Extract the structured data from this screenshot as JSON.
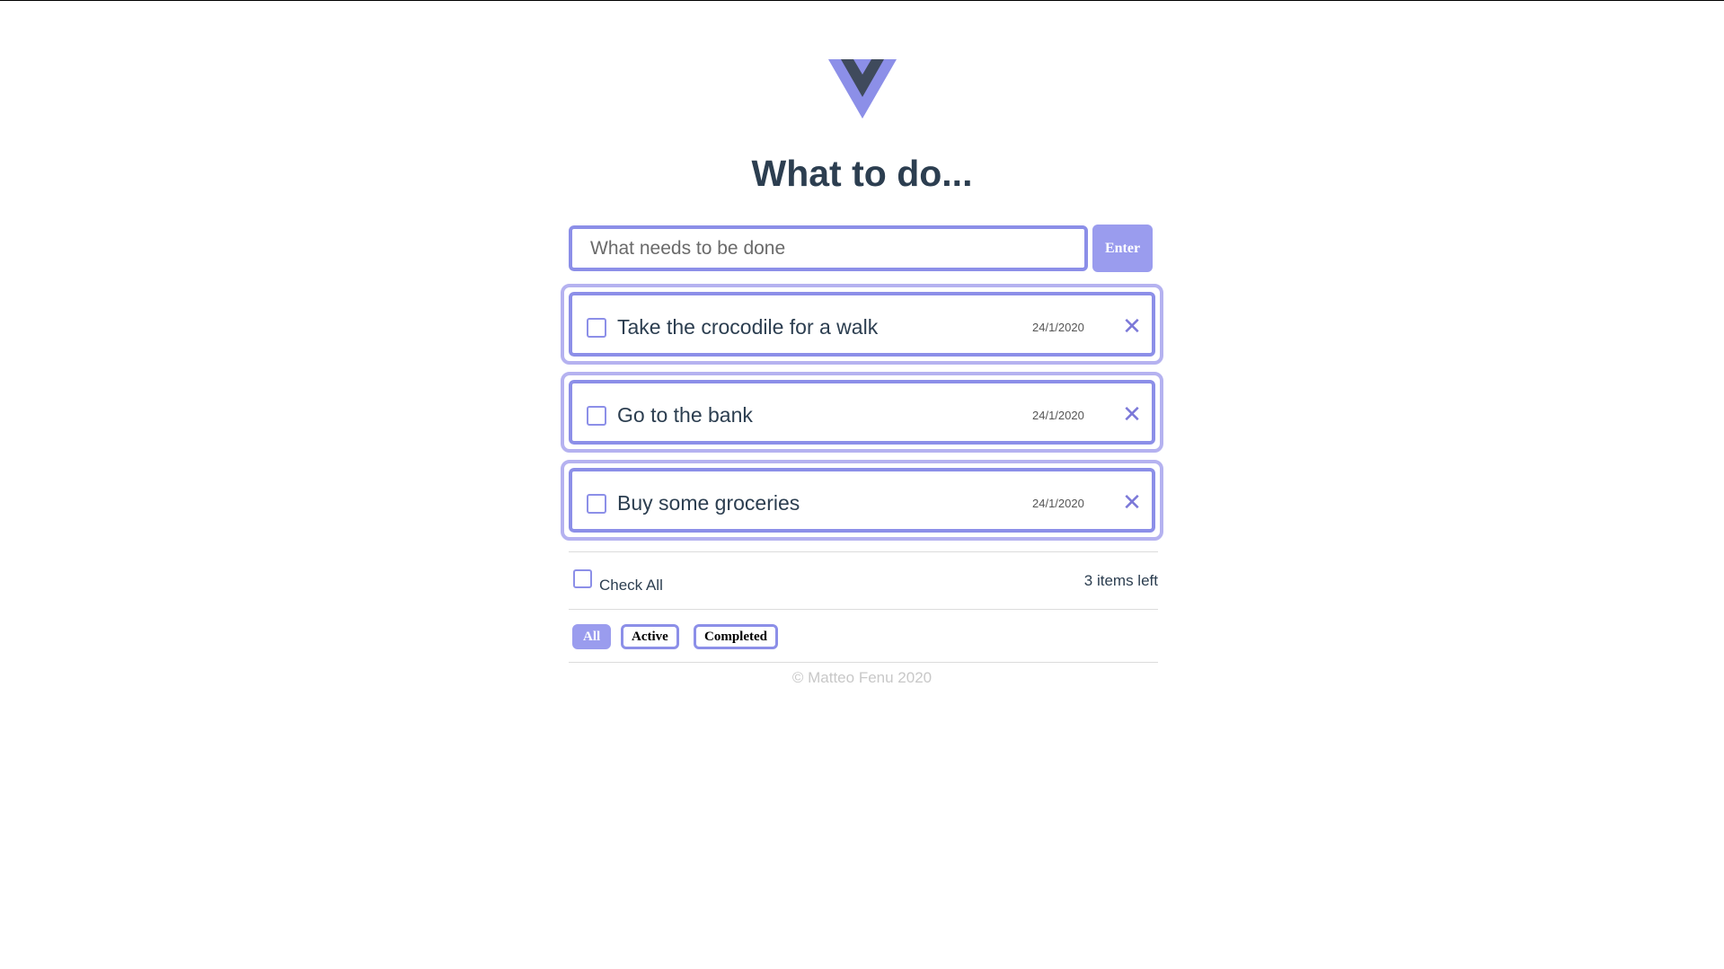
{
  "colors": {
    "accent": "#8c8fe8",
    "accent_light": "#b5b2f0",
    "button": "#9a9cee",
    "text": "#2c3e50",
    "delete": "#7b78d8"
  },
  "header": {
    "logo_icon": "vue-logo-icon",
    "title": "What to do..."
  },
  "new_todo": {
    "placeholder": "What needs to be done",
    "value": "",
    "enter_label": "Enter"
  },
  "todos": [
    {
      "text": "Take the crocodile for a walk",
      "date": "24/1/2020",
      "done": false,
      "delete_icon": "close-icon"
    },
    {
      "text": "Go to the bank",
      "date": "24/1/2020",
      "done": false,
      "delete_icon": "close-icon"
    },
    {
      "text": "Buy some groceries",
      "date": "24/1/2020",
      "done": false,
      "delete_icon": "close-icon"
    }
  ],
  "controls": {
    "check_all_label": "Check All",
    "items_left_count": "3",
    "items_left_text": "items left"
  },
  "filters": [
    {
      "label": "All",
      "selected": true
    },
    {
      "label": "Active",
      "selected": false
    },
    {
      "label": "Completed",
      "selected": false
    }
  ],
  "footer": {
    "copyright": "© Matteo Fenu 2020"
  }
}
